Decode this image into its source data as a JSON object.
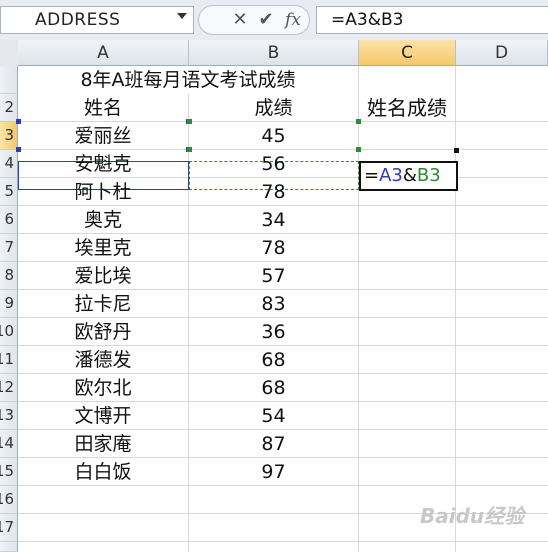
{
  "formula_bar": {
    "name_box": "ADDRESS",
    "cancel_icon": "✕",
    "enter_icon": "✔",
    "fx_label": "fx",
    "formula": "=A3&B3"
  },
  "columns": [
    "A",
    "B",
    "C",
    "D"
  ],
  "rows": [
    "2",
    "3",
    "4",
    "5",
    "6",
    "7",
    "8",
    "9",
    "10",
    "11",
    "12",
    "13",
    "14",
    "15",
    "16",
    "17"
  ],
  "sheet": {
    "title": "8年A班每月语文考试成绩",
    "headers": {
      "name": "姓名",
      "score": "成绩",
      "combined": "姓名成绩"
    },
    "students": [
      {
        "name": "爱丽丝",
        "score": "45"
      },
      {
        "name": "安魁克",
        "score": "56"
      },
      {
        "name": "阿卜杜",
        "score": "78"
      },
      {
        "name": "奥克",
        "score": "34"
      },
      {
        "name": "埃里克",
        "score": "78"
      },
      {
        "name": "爱比埃",
        "score": "57"
      },
      {
        "name": "拉卡尼",
        "score": "83"
      },
      {
        "name": "欧舒丹",
        "score": "36"
      },
      {
        "name": "潘德发",
        "score": "68"
      },
      {
        "name": "欧尔北",
        "score": "68"
      },
      {
        "name": "文博开",
        "score": "54"
      },
      {
        "name": "田家庵",
        "score": "87"
      },
      {
        "name": "白白饭",
        "score": "97"
      }
    ],
    "edit_cell": {
      "eq": "=",
      "ref_a": "A3",
      "amp": "&",
      "ref_b": "B3"
    }
  },
  "watermark": "Baidu经验",
  "colors": {
    "ref_a": "#2b3cba",
    "ref_b": "#2e8b2e",
    "active_header": "#f6c86a"
  }
}
